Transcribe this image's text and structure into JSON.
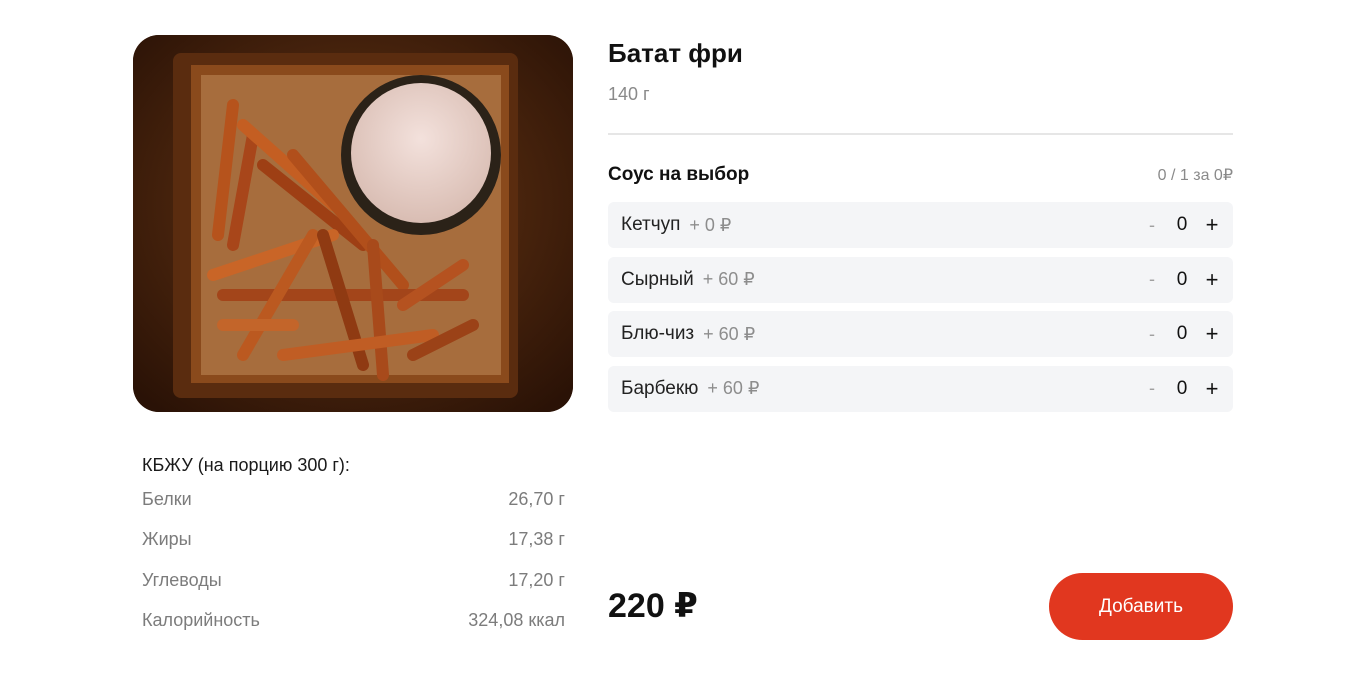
{
  "product": {
    "image_alt": "Батат фри",
    "title": "Батат фри",
    "weight": "140 г",
    "price": "220 ₽",
    "add_label": "Добавить"
  },
  "nutrition": {
    "header": "КБЖУ (на порцию 300 г):",
    "rows": [
      {
        "label": "Белки",
        "value": "26,70 г"
      },
      {
        "label": "Жиры",
        "value": "17,38 г"
      },
      {
        "label": "Углеводы",
        "value": "17,20 г"
      },
      {
        "label": "Калорийность",
        "value": "324,08 ккал"
      }
    ]
  },
  "sauces": {
    "title": "Соус на выбор",
    "limit": "0 / 1 за 0₽",
    "items": [
      {
        "name": "Кетчуп",
        "price": "+ 0 ₽",
        "qty": "0",
        "minus": "-",
        "plus": "+"
      },
      {
        "name": "Сырный",
        "price": "+ 60 ₽",
        "qty": "0",
        "minus": "-",
        "plus": "+"
      },
      {
        "name": "Блю-чиз",
        "price": "+ 60 ₽",
        "qty": "0",
        "minus": "-",
        "plus": "+"
      },
      {
        "name": "Барбекю",
        "price": "+ 60 ₽",
        "qty": "0",
        "minus": "-",
        "plus": "+"
      }
    ]
  },
  "colors": {
    "accent": "#e1371f",
    "option_bg": "#f4f5f7",
    "muted_text": "#8a8a8a"
  }
}
